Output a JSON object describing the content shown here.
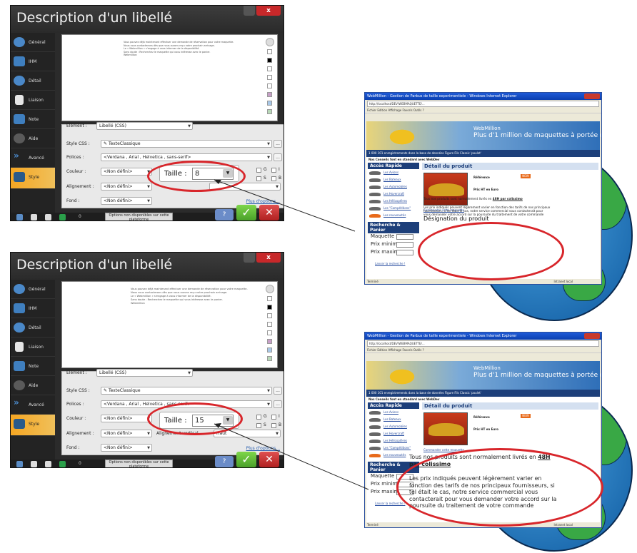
{
  "dialog": {
    "title": "Description d'un libellé",
    "sidebar": [
      {
        "label": "Général",
        "icon": "general-icon"
      },
      {
        "label": "IHM",
        "icon": "ihm-icon"
      },
      {
        "label": "Détail",
        "icon": "detail-icon"
      },
      {
        "label": "Liaison",
        "icon": "liaison-icon"
      },
      {
        "label": "Note",
        "icon": "note-icon"
      },
      {
        "label": "Aide",
        "icon": "aide-icon"
      },
      {
        "label": "Avancé",
        "icon": "avance-icon"
      },
      {
        "label": "Style",
        "icon": "style-icon"
      }
    ],
    "element_label": "Elément :",
    "element_value": "Libellé (CSS)",
    "style_css_label": "Style CSS :",
    "style_css_value": "TexteClassique",
    "polices_label": "Polices :",
    "polices_value": "<Verdana , Arial , Helvetica , sans-serif>",
    "couleur_label": "Couleur :",
    "couleur_value": "<Non défini>",
    "alignement_label": "Alignement :",
    "alignement_value": "<Non défini>",
    "alignement_vertical_label": "Alignement vertical",
    "alignement_vertical_value": "Haut",
    "fond_label": "Fond :",
    "fond_value": "<Non défini>",
    "taille_label": "Taille :",
    "gras": "G",
    "souligne": "S",
    "italique": "I",
    "barre": "B",
    "options_link": "Plus d'options...",
    "status_number": "0",
    "status_note": "Options non disponibles sur cette plateforme",
    "dots": "...",
    "editor_text": "Vous pouvez déjà maintenant effectuer une demande de réservation pour votre maquette.\nNous vous contacterons dès que nous aurons reçu notre prochain arrivage.\nLe « Webmillion » s'engage à vous informer de la disponibilité.\nSans doute : Recherchez le maquette qui vous intéresse avec le panier.\nWebmillion"
  },
  "dialog1": {
    "taille_value": "8"
  },
  "dialog2": {
    "taille_value": "15"
  },
  "browser": {
    "title": "WebMillion - Gestion de Parbus de taille experimentiele - Windows Internet Explorer",
    "menu": "Fichier  Edition  Affichage  Favoris  Outils  ?",
    "address": "http://localhost/DEV/WEBMAQUETTE/...",
    "brand": "WebMillion",
    "slogan": "Plus d'1 million de maquettes à portée de clic",
    "strip": "1 000 101 enregistrements dans la base de données Figure Fils Classic 'poulet'",
    "crumb": "Nos Conseils font en standard avec WebDev",
    "nav_head": "Accès Rapide",
    "nav_items": [
      "Les Avions",
      "Les Bateaux",
      "Les Automobiles",
      "Les Hovercraft",
      "Les Hélicoptères",
      "Les \"Compétitions\"",
      "Les nouveautés"
    ],
    "search_head": "Recherche & Panier",
    "search_maquette": "Maquette",
    "search_prix_min": "Prix minimum",
    "search_prix_max": "Prix maximum :",
    "search_link": "Lancer la recherche !",
    "product_head": "Détail du produit",
    "reference": "Référence",
    "price": "Prix HT en Euro",
    "new_badge": "NEW",
    "order_link": "Commander cette maquette",
    "designation": "Désignation du produit",
    "desc1_a": "Tous nos produits sont normalement livrés en ",
    "desc1_b": "48H par colissimo",
    "desc2": "Les prix indiqués peuvent légèrement varier en fonction des tarifs de nos principaux fournisseurs, si tel était le cas, notre service commercial vous contacterait pour vous demander votre accord sur la poursuite du traitement de votre commande",
    "status_left": "Terminé",
    "status_right": "Intranet local"
  },
  "colors": {
    "accent": "#f5a623",
    "highlight": "#d8262b",
    "banner": "#2f6fb8",
    "ok": "#4aa02a",
    "cancel": "#c8282a"
  }
}
